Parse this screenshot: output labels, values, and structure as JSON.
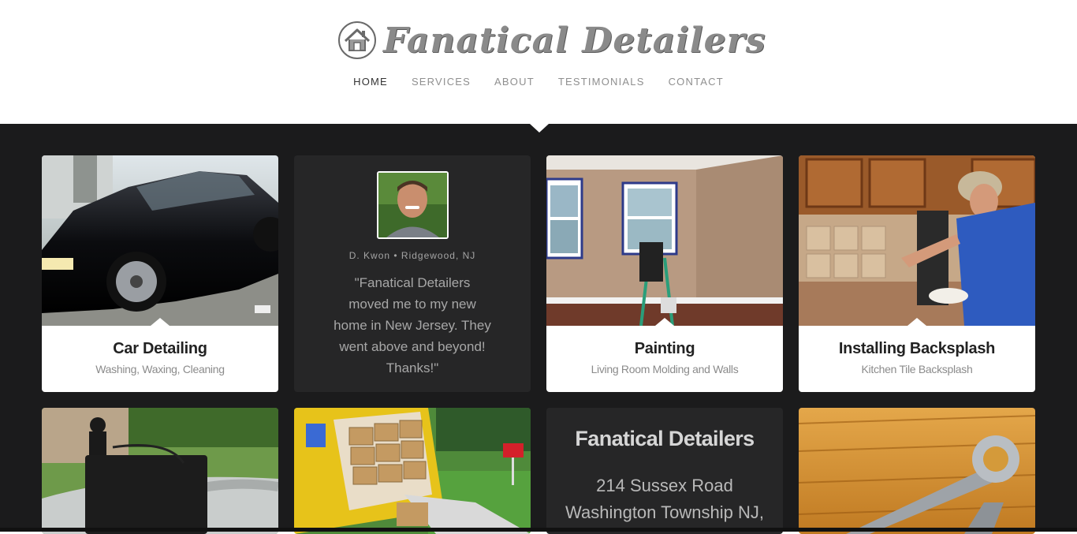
{
  "site": {
    "title": "Fanatical Detailers",
    "logo_icon": "house-icon"
  },
  "nav": {
    "items": [
      {
        "label": "HOME",
        "active": true
      },
      {
        "label": "SERVICES",
        "active": false
      },
      {
        "label": "ABOUT",
        "active": false
      },
      {
        "label": "TESTIMONIALS",
        "active": false
      },
      {
        "label": "CONTACT",
        "active": false
      }
    ]
  },
  "tiles": {
    "car": {
      "title": "Car Detailing",
      "subtitle": "Washing, Waxing, Cleaning"
    },
    "testimonial": {
      "author": "D. Kwon • Ridgewood, NJ",
      "quote": "\"Fanatical Detailers moved me to my new home in New Jersey. They went above and beyond! Thanks!\""
    },
    "painting": {
      "title": "Painting",
      "subtitle": "Living Room Molding and Walls"
    },
    "backsplash": {
      "title": "Installing Backsplash",
      "subtitle": "Kitchen Tile Backsplash"
    },
    "contact": {
      "name": "Fanatical Detailers",
      "address_line1": "214 Sussex Road",
      "address_line2": "Washington Township NJ,"
    }
  },
  "colors": {
    "background_dark": "#1b1b1c",
    "tile_dark": "#262627",
    "nav_active": "#333333",
    "nav_inactive": "#8f8f8f"
  }
}
